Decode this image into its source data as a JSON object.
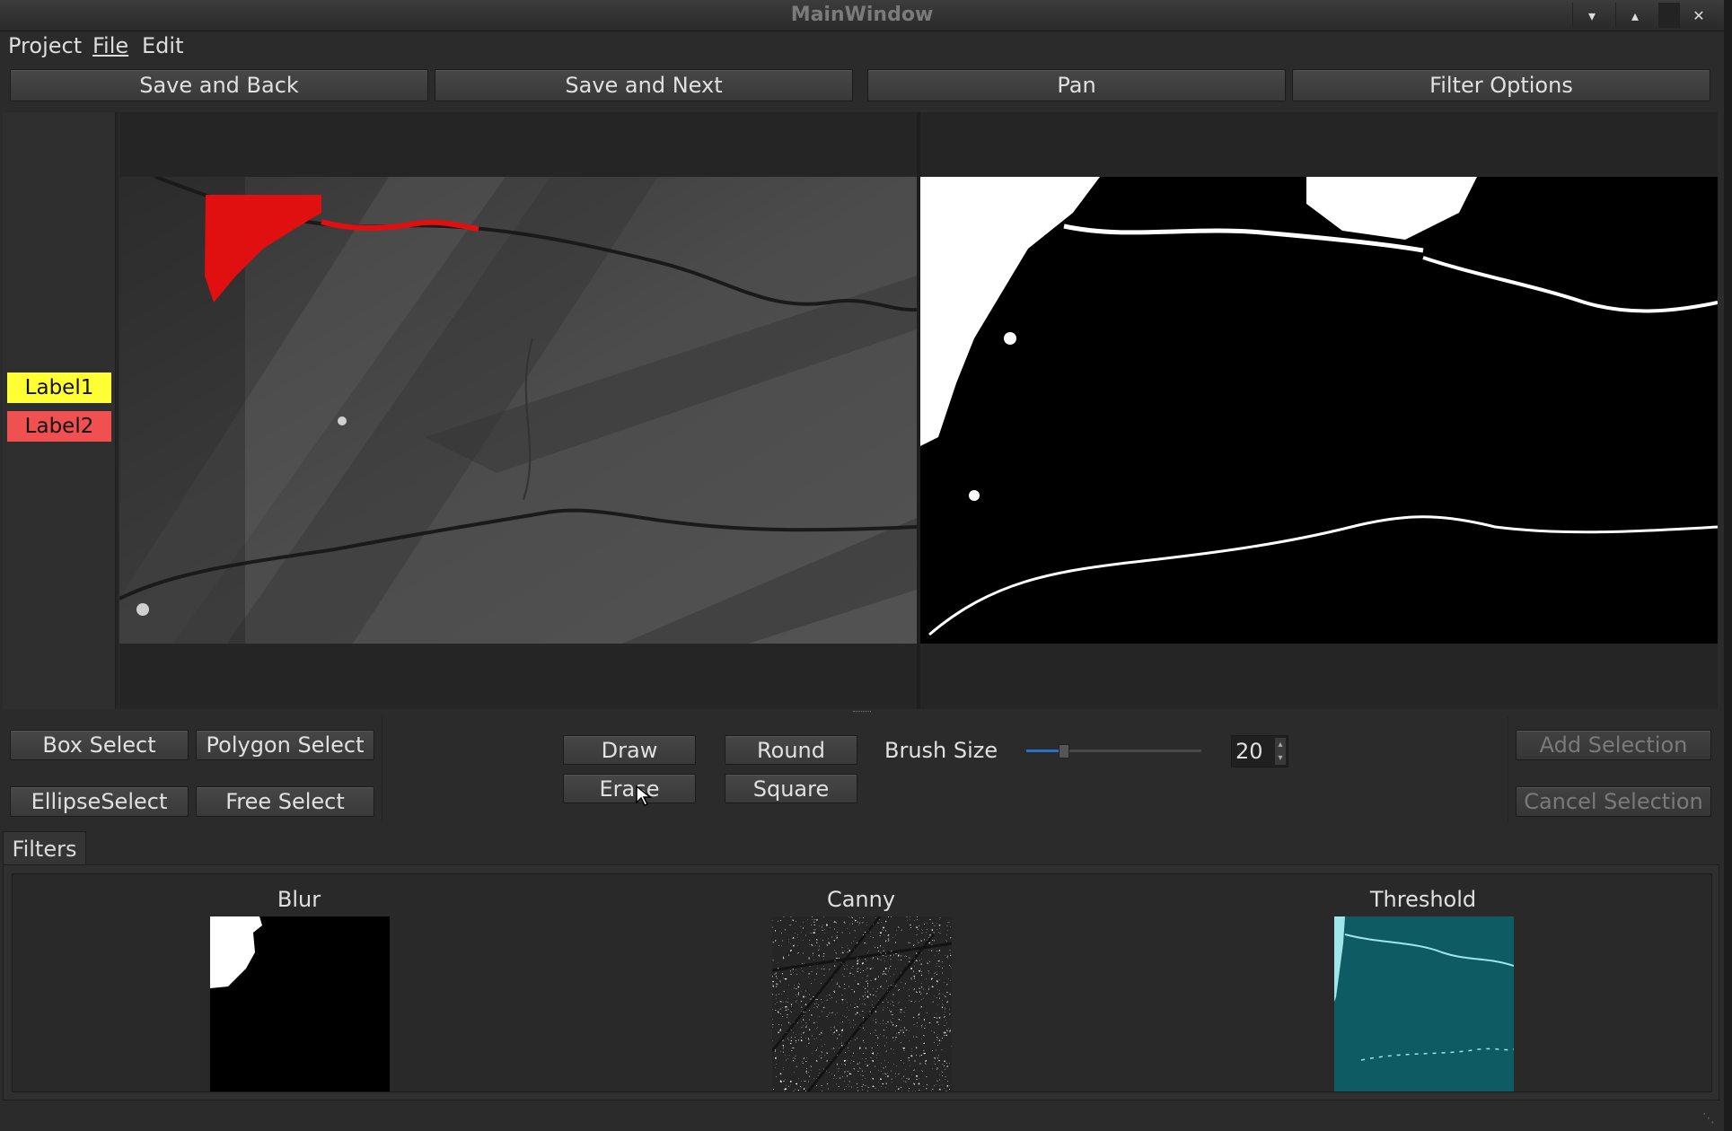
{
  "window": {
    "title": "MainWindow"
  },
  "menu": {
    "project": "Project",
    "file": "File",
    "edit": "Edit"
  },
  "toolbar": {
    "save_back": "Save and Back",
    "save_next": "Save and Next",
    "pan": "Pan",
    "filter_options": "Filter Options"
  },
  "labels": [
    {
      "name": "Label1",
      "color": "#ffff33"
    },
    {
      "name": "Label2",
      "color": "#f05050"
    }
  ],
  "selection": {
    "box": "Box Select",
    "polygon": "Polygon Select",
    "ellipse": "EllipseSelect",
    "free": "Free Select",
    "add": "Add Selection",
    "cancel": "Cancel Selection"
  },
  "brush": {
    "draw": "Draw",
    "erase": "Erase",
    "round": "Round",
    "square": "Square",
    "size_label": "Brush Size",
    "size_value": "20"
  },
  "filters": {
    "tab": "Filters",
    "items": [
      {
        "name": "Blur"
      },
      {
        "name": "Canny"
      },
      {
        "name": "Threshold"
      }
    ]
  },
  "colors": {
    "annotation": "#e01010",
    "threshold_tint": "#0f5b63"
  },
  "icons": [
    "minimize-icon",
    "maximize-icon",
    "close-icon",
    "resize-grip-icon"
  ]
}
